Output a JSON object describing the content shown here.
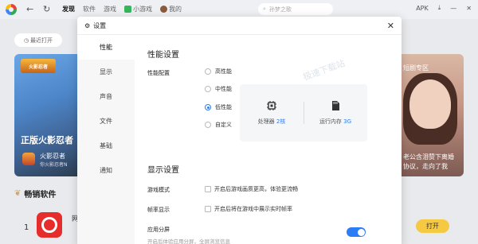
{
  "topbar": {
    "nav": [
      "发现",
      "软件",
      "游戏"
    ],
    "mini_games": "小游戏",
    "mine": "我的",
    "search_placeholder": "孙梦之歌",
    "apk": "APK"
  },
  "background": {
    "recent": "最近打开",
    "banner_left": {
      "logo_text": "火影忍者",
      "title": "正版火影忍者",
      "name": "火影忍者",
      "subtitle": "你火影忍者N"
    },
    "banner_right": {
      "title": "短剧专区",
      "text1": "老公含泪赞下离婚",
      "text2": "协议，走向了我"
    },
    "bestseller_title": "畅销软件",
    "rank": "1",
    "row_sliver": "网",
    "open_label": "打开"
  },
  "dialog": {
    "title": "设置",
    "watermark": "极速下载站",
    "sidebar": [
      "性能",
      "显示",
      "声音",
      "文件",
      "基础",
      "通知"
    ],
    "perf": {
      "section_title": "性能设置",
      "config_label": "性能配置",
      "options": [
        "高性能",
        "中性能",
        "低性能",
        "自定义"
      ],
      "selected_index": 2,
      "cpu_label": "处理器",
      "cpu_value": "2核",
      "ram_label": "运行内存",
      "ram_value": "3G"
    },
    "display": {
      "section_title": "显示设置",
      "game_mode_label": "游戏模式",
      "game_mode_text": "开启后游戏画质更高，体验更流畅",
      "fps_label": "帧率显示",
      "fps_text": "开启后将在游戏中展示实时帧率",
      "split_label": "应用分屏",
      "split_desc": "开启后体验应用分屏，全屏浏览信息",
      "split_on": true
    }
  },
  "colors": {
    "accent": "#2d7cf6",
    "open_button": "#f6c943"
  }
}
